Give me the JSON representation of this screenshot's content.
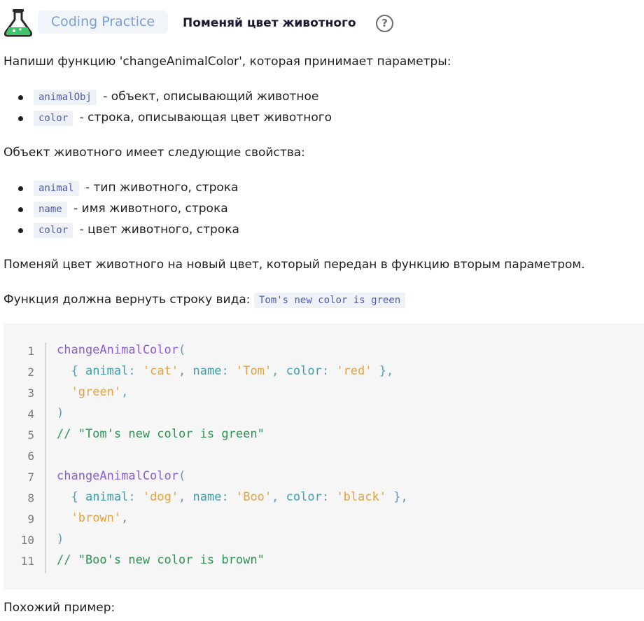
{
  "header": {
    "badge": "Coding Practice",
    "title": "Поменяй цвет животного",
    "help_icon": "?"
  },
  "intro": "Напиши функцию 'changeAnimalColor', которая принимает параметры:",
  "params": [
    {
      "code": "animalObj",
      "text": "- объект, описывающий животное"
    },
    {
      "code": "color",
      "text": "- строка, описывающая цвет животного"
    }
  ],
  "props_intro": "Объект животного имеет следующие свойства:",
  "props": [
    {
      "code": "animal",
      "text": "- тип животного, строка"
    },
    {
      "code": "name",
      "text": "- имя животного, строка"
    },
    {
      "code": "color",
      "text": "- цвет животного, строка"
    }
  ],
  "task": "Поменяй цвет животного на новый цвет, который передан в функцию вторым параметром.",
  "return_text": "Функция должна вернуть строку вида:",
  "return_code": "Tom's new color is green",
  "code_lines": [
    {
      "n": "1",
      "tokens": [
        {
          "t": "changeAnimalColor",
          "c": "fn"
        },
        {
          "t": "(",
          "c": "pun"
        }
      ]
    },
    {
      "n": "2",
      "tokens": [
        {
          "t": "  { ",
          "c": "pun"
        },
        {
          "t": "animal",
          "c": "key"
        },
        {
          "t": ": ",
          "c": "pun"
        },
        {
          "t": "'cat'",
          "c": "str"
        },
        {
          "t": ", ",
          "c": "pun"
        },
        {
          "t": "name",
          "c": "key"
        },
        {
          "t": ": ",
          "c": "pun"
        },
        {
          "t": "'Tom'",
          "c": "str"
        },
        {
          "t": ", ",
          "c": "pun"
        },
        {
          "t": "color",
          "c": "key"
        },
        {
          "t": ": ",
          "c": "pun"
        },
        {
          "t": "'red'",
          "c": "str"
        },
        {
          "t": " },",
          "c": "pun"
        }
      ]
    },
    {
      "n": "3",
      "tokens": [
        {
          "t": "  ",
          "c": "pun"
        },
        {
          "t": "'green'",
          "c": "str"
        },
        {
          "t": ",",
          "c": "pun"
        }
      ]
    },
    {
      "n": "4",
      "tokens": [
        {
          "t": ")",
          "c": "pun"
        }
      ]
    },
    {
      "n": "5",
      "tokens": [
        {
          "t": "// \"Tom's new color is green\"",
          "c": "com"
        }
      ]
    },
    {
      "n": "6",
      "tokens": []
    },
    {
      "n": "7",
      "tokens": [
        {
          "t": "changeAnimalColor",
          "c": "fn"
        },
        {
          "t": "(",
          "c": "pun"
        }
      ]
    },
    {
      "n": "8",
      "tokens": [
        {
          "t": "  { ",
          "c": "pun"
        },
        {
          "t": "animal",
          "c": "key"
        },
        {
          "t": ": ",
          "c": "pun"
        },
        {
          "t": "'dog'",
          "c": "str"
        },
        {
          "t": ", ",
          "c": "pun"
        },
        {
          "t": "name",
          "c": "key"
        },
        {
          "t": ": ",
          "c": "pun"
        },
        {
          "t": "'Boo'",
          "c": "str"
        },
        {
          "t": ", ",
          "c": "pun"
        },
        {
          "t": "color",
          "c": "key"
        },
        {
          "t": ": ",
          "c": "pun"
        },
        {
          "t": "'black'",
          "c": "str"
        },
        {
          "t": " },",
          "c": "pun"
        }
      ]
    },
    {
      "n": "9",
      "tokens": [
        {
          "t": "  ",
          "c": "pun"
        },
        {
          "t": "'brown'",
          "c": "str"
        },
        {
          "t": ",",
          "c": "pun"
        }
      ]
    },
    {
      "n": "10",
      "tokens": [
        {
          "t": ")",
          "c": "pun"
        }
      ]
    },
    {
      "n": "11",
      "tokens": [
        {
          "t": "// \"Boo's new color is brown\"",
          "c": "com"
        }
      ]
    }
  ],
  "similar": "Похожий пример:"
}
